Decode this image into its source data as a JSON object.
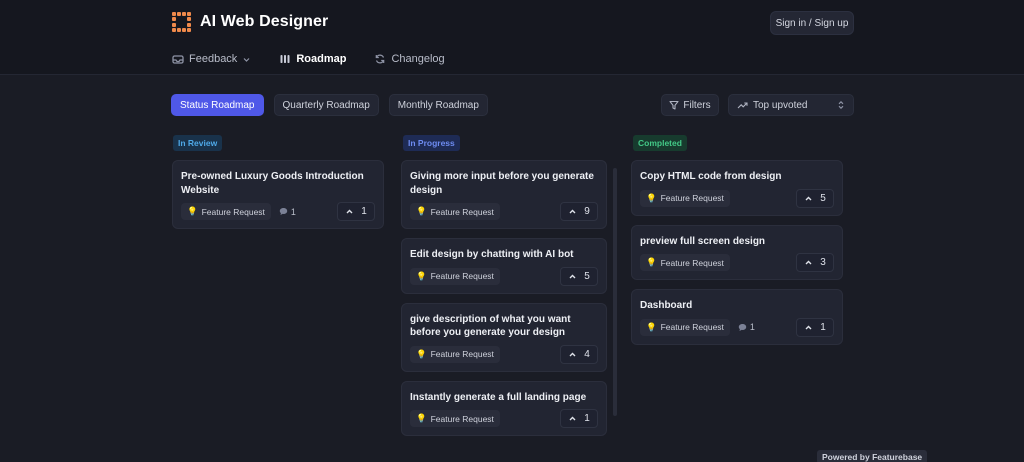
{
  "header": {
    "app_name": "AI Web Designer",
    "sign_in_label": "Sign in / Sign up",
    "nav": [
      {
        "label": "Feedback",
        "icon": "inbox-icon"
      },
      {
        "label": "Roadmap",
        "icon": "roadmap-icon"
      },
      {
        "label": "Changelog",
        "icon": "refresh-icon"
      }
    ]
  },
  "toolbar": {
    "tabs": [
      "Status Roadmap",
      "Quarterly Roadmap",
      "Monthly Roadmap"
    ],
    "active_tab": "Status Roadmap",
    "filters_label": "Filters",
    "sort_label": "Top upvoted"
  },
  "columns": [
    {
      "status": "In Review",
      "color": "#4fa9e8",
      "cards": [
        {
          "title": "Pre-owned Luxury Goods Introduction Website",
          "tag": "Feature Request",
          "comments": "1",
          "votes": "1"
        }
      ]
    },
    {
      "status": "In Progress",
      "color": "#6e8cf2",
      "cards": [
        {
          "title": "Giving more input before you generate design",
          "tag": "Feature Request",
          "votes": "9"
        },
        {
          "title": "Edit design by chatting with AI bot",
          "tag": "Feature Request",
          "votes": "5"
        },
        {
          "title": "give description of what you want before you generate your design",
          "tag": "Feature Request",
          "votes": "4"
        },
        {
          "title": "Instantly generate a full landing page",
          "tag": "Feature Request",
          "votes": "1"
        }
      ]
    },
    {
      "status": "Completed",
      "color": "#43c987",
      "cards": [
        {
          "title": "Copy HTML code from design",
          "tag": "Feature Request",
          "votes": "5"
        },
        {
          "title": "preview full screen design",
          "tag": "Feature Request",
          "votes": "3"
        },
        {
          "title": "Dashboard",
          "tag": "Feature Request",
          "comments": "1",
          "votes": "1"
        }
      ]
    }
  ],
  "footer": {
    "powered_by": "Powered by Featurebase"
  },
  "colors": {
    "accent": "#4f58e8",
    "brand_logo": "#f08a4b",
    "background": "#1a1c25"
  }
}
